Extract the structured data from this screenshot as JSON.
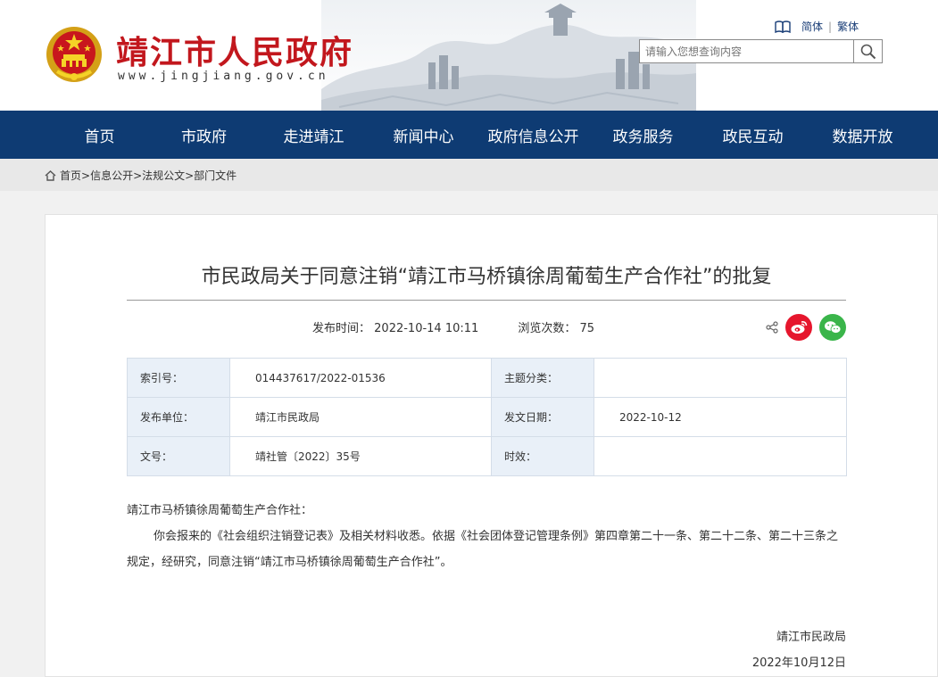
{
  "header": {
    "site_title": "靖江市人民政府",
    "site_url": "www.jingjiang.gov.cn",
    "lang_simplified": "简体",
    "lang_traditional": "繁体",
    "search_placeholder": "请输入您想查询内容"
  },
  "nav": {
    "items": [
      "首页",
      "市政府",
      "走进靖江",
      "新闻中心",
      "政府信息公开",
      "政务服务",
      "政民互动",
      "数据开放"
    ]
  },
  "breadcrumb": {
    "home": "首页",
    "path": ">信息公开>法规公文>部门文件"
  },
  "article": {
    "title": "市民政局关于同意注销“靖江市马桥镇徐周葡萄生产合作社”的批复",
    "publish_label": "发布时间：",
    "publish_time": "2022-10-14 10:11",
    "views_label": "浏览次数：",
    "views": "75"
  },
  "info_table": {
    "rows": [
      {
        "l1": "索引号：",
        "v1": "014437617/2022-01536",
        "l2": "主题分类：",
        "v2": ""
      },
      {
        "l1": "发布单位：",
        "v1": "靖江市民政局",
        "l2": "发文日期：",
        "v2": "2022-10-12"
      },
      {
        "l1": "文号：",
        "v1": "靖社管〔2022〕35号",
        "l2": "时效：",
        "v2": ""
      }
    ]
  },
  "body": {
    "salutation": "靖江市马桥镇徐周葡萄生产合作社：",
    "paragraph": "你会报来的《社会组织注销登记表》及相关材料收悉。依据《社会团体登记管理条例》第四章第二十一条、第二十二条、第二十三条之规定，经研究，同意注销“靖江市马桥镇徐周葡萄生产合作社”。",
    "signature": "靖江市民政局",
    "date": "2022年10月12日"
  },
  "colors": {
    "nav_bg": "#0e3b73",
    "title_red": "#c2171d",
    "weibo": "#e6162d",
    "wechat": "#3ab54a"
  }
}
